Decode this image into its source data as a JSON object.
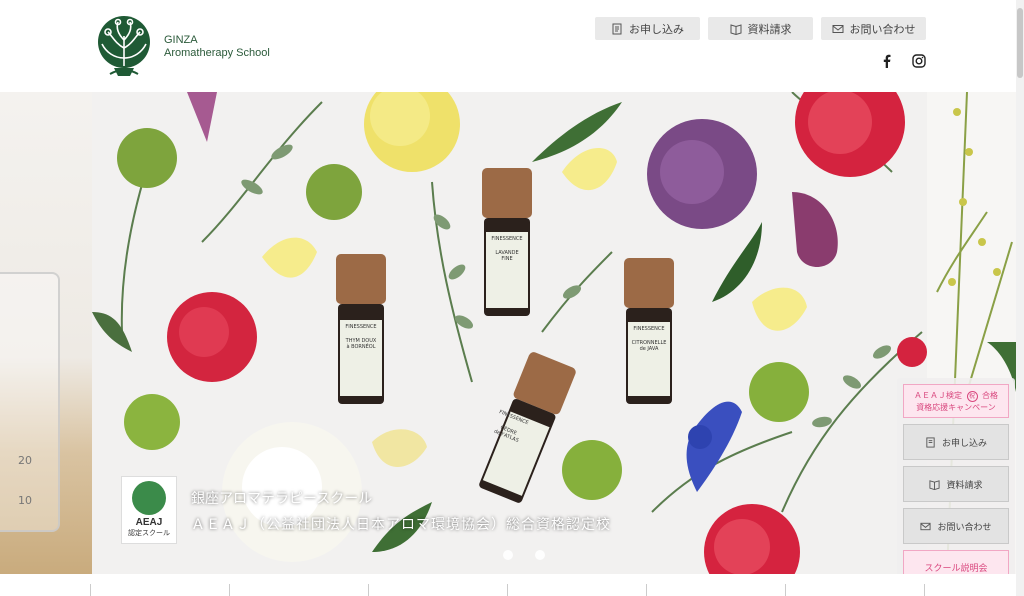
{
  "logo": {
    "line1": "GINZA",
    "line2": "Aromatherapy School"
  },
  "top_buttons": [
    {
      "label": "お申し込み",
      "icon": "document-icon"
    },
    {
      "label": "資料請求",
      "icon": "book-icon"
    },
    {
      "label": "お問い合わせ",
      "icon": "mail-icon"
    }
  ],
  "social": [
    "facebook-icon",
    "instagram-icon"
  ],
  "hero": {
    "caption1": "銀座アロマテラピースクール",
    "caption2": "ＡＥＡＪ（公益社団法人日本アロマ環境協会）総合資格認定校",
    "badge_title": "AEAJ",
    "badge_sub": "認定スクール",
    "bottles": [
      {
        "brand": "FINESSENCE",
        "name1": "THYM DOUX",
        "name2": "à BORNÉOL"
      },
      {
        "brand": "FINESSENCE",
        "name1": "LAVANDE",
        "name2": "FINE"
      },
      {
        "brand": "FINESSENCE",
        "name1": "CITRONNELLE",
        "name2": "de JAVA"
      },
      {
        "brand": "FINESSENCE",
        "name1": "CÈDRE",
        "name2": "de l'ATLAS"
      }
    ],
    "beaker_marks": [
      "20",
      "10"
    ]
  },
  "side": {
    "campaign_line1": "ＡＥＡＪ検定",
    "campaign_mark": "祝",
    "campaign_line1b": "合格",
    "campaign_line2": "資格応援キャンペーン",
    "buttons": [
      {
        "label": "お申し込み",
        "icon": "document-icon"
      },
      {
        "label": "資料請求",
        "icon": "book-icon"
      },
      {
        "label": "お問い合わせ",
        "icon": "mail-icon"
      }
    ],
    "school_label": "スクール説明会"
  },
  "colors": {
    "brand_green": "#1f5a35",
    "pink": "#d9477e"
  }
}
